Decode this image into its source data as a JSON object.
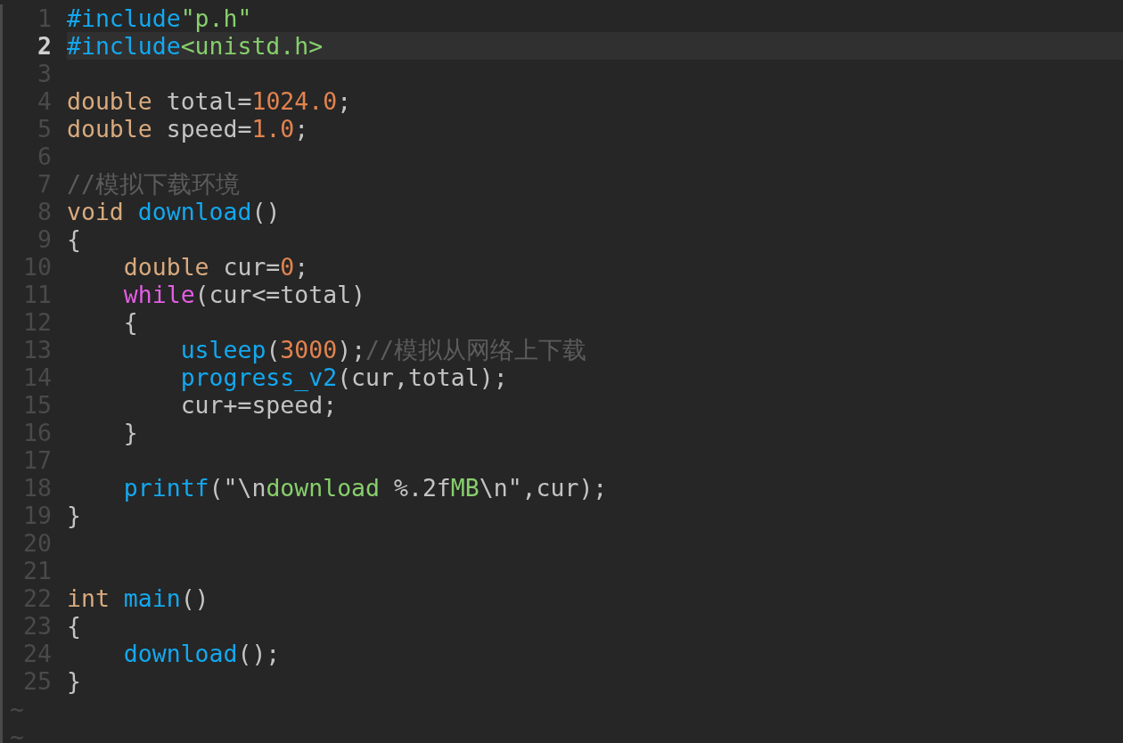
{
  "editor": {
    "lines": [
      {
        "number": "1",
        "current": false,
        "tokens": [
          {
            "kind": "preproc",
            "text": "#include"
          },
          {
            "kind": "string",
            "text": "\"p.h\""
          }
        ]
      },
      {
        "number": "2",
        "current": true,
        "tokens": [
          {
            "kind": "preproc",
            "text": "#include"
          },
          {
            "kind": "string",
            "text": "<unistd.h>"
          }
        ]
      },
      {
        "number": "3",
        "current": false
      },
      {
        "number": "4",
        "current": false,
        "tokens": [
          {
            "kind": "type",
            "text": "double"
          },
          {
            "kind": "plain",
            "text": " total="
          },
          {
            "kind": "number",
            "text": "1024.0"
          },
          {
            "kind": "plain",
            "text": ";"
          }
        ]
      },
      {
        "number": "5",
        "current": false,
        "tokens": [
          {
            "kind": "type",
            "text": "double"
          },
          {
            "kind": "plain",
            "text": " speed="
          },
          {
            "kind": "number",
            "text": "1.0"
          },
          {
            "kind": "plain",
            "text": ";"
          }
        ]
      },
      {
        "number": "6",
        "current": false
      },
      {
        "number": "7",
        "current": false,
        "tokens": [
          {
            "kind": "comment",
            "text": "//模拟下载环境"
          }
        ]
      },
      {
        "number": "8",
        "current": false,
        "tokens": [
          {
            "kind": "type",
            "text": "void "
          },
          {
            "kind": "function",
            "text": "download"
          },
          {
            "kind": "plain",
            "text": "()"
          }
        ]
      },
      {
        "number": "9",
        "current": false,
        "tokens": [
          {
            "kind": "plain",
            "text": "{"
          }
        ]
      },
      {
        "number": "10",
        "current": false,
        "tokens": [
          {
            "kind": "type",
            "text": "    double"
          },
          {
            "kind": "plain",
            "text": " cur="
          },
          {
            "kind": "number",
            "text": "0"
          },
          {
            "kind": "plain",
            "text": ";"
          }
        ]
      },
      {
        "number": "11",
        "current": false,
        "tokens": [
          {
            "kind": "keyword",
            "text": "    while"
          },
          {
            "kind": "plain",
            "text": "(cur<=total)"
          }
        ]
      },
      {
        "number": "12",
        "current": false,
        "tokens": [
          {
            "kind": "plain",
            "text": "    {"
          }
        ]
      },
      {
        "number": "13",
        "current": false,
        "tokens": [
          {
            "kind": "function",
            "text": "        usleep"
          },
          {
            "kind": "plain",
            "text": "("
          },
          {
            "kind": "number",
            "text": "3000"
          },
          {
            "kind": "plain",
            "text": ");"
          },
          {
            "kind": "comment",
            "text": "//模拟从网络上下载"
          }
        ]
      },
      {
        "number": "14",
        "current": false,
        "tokens": [
          {
            "kind": "function",
            "text": "        progress_v2"
          },
          {
            "kind": "plain",
            "text": "(cur,total);"
          }
        ]
      },
      {
        "number": "15",
        "current": false,
        "tokens": [
          {
            "kind": "plain",
            "text": "        cur+=speed;"
          }
        ]
      },
      {
        "number": "16",
        "current": false,
        "tokens": [
          {
            "kind": "plain",
            "text": "    }"
          }
        ]
      },
      {
        "number": "17",
        "current": false
      },
      {
        "number": "18",
        "current": false,
        "tokens": [
          {
            "kind": "function",
            "text": "    printf"
          },
          {
            "kind": "plain",
            "text": "(\"\\n"
          },
          {
            "kind": "string",
            "text": "download "
          },
          {
            "kind": "plain",
            "text": "%.2f"
          },
          {
            "kind": "string",
            "text": "MB"
          },
          {
            "kind": "plain",
            "text": "\\n\",cur);"
          }
        ]
      },
      {
        "number": "19",
        "current": false,
        "tokens": [
          {
            "kind": "plain",
            "text": "}"
          }
        ]
      },
      {
        "number": "20",
        "current": false
      },
      {
        "number": "21",
        "current": false
      },
      {
        "number": "22",
        "current": false,
        "tokens": [
          {
            "kind": "type",
            "text": "int "
          },
          {
            "kind": "function",
            "text": "main"
          },
          {
            "kind": "plain",
            "text": "()"
          }
        ]
      },
      {
        "number": "23",
        "current": false,
        "tokens": [
          {
            "kind": "plain",
            "text": "{"
          }
        ]
      },
      {
        "number": "24",
        "current": false,
        "tokens": [
          {
            "kind": "function",
            "text": "    download"
          },
          {
            "kind": "plain",
            "text": "();"
          }
        ]
      },
      {
        "number": "25",
        "current": false,
        "tokens": [
          {
            "kind": "plain",
            "text": "}"
          }
        ]
      }
    ],
    "filler": [
      "~",
      "~"
    ]
  }
}
